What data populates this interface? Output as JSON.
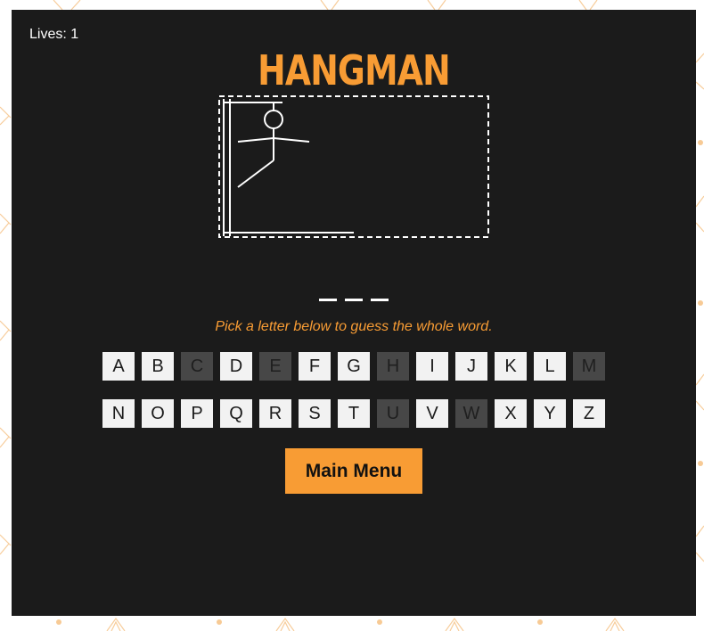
{
  "game": {
    "lives_label": "Lives: 1",
    "title": "HANGMAN",
    "instructions": "Pick a letter below to guess the whole word.",
    "word_slots": [
      "",
      "",
      ""
    ],
    "keyboard_rows": [
      [
        {
          "letter": "A",
          "used": false
        },
        {
          "letter": "B",
          "used": false
        },
        {
          "letter": "C",
          "used": true
        },
        {
          "letter": "D",
          "used": false
        },
        {
          "letter": "E",
          "used": true
        },
        {
          "letter": "F",
          "used": false
        },
        {
          "letter": "G",
          "used": false
        },
        {
          "letter": "H",
          "used": true
        },
        {
          "letter": "I",
          "used": false
        },
        {
          "letter": "J",
          "used": false
        },
        {
          "letter": "K",
          "used": false
        },
        {
          "letter": "L",
          "used": false
        },
        {
          "letter": "M",
          "used": true
        }
      ],
      [
        {
          "letter": "N",
          "used": false
        },
        {
          "letter": "O",
          "used": false
        },
        {
          "letter": "P",
          "used": false
        },
        {
          "letter": "Q",
          "used": false
        },
        {
          "letter": "R",
          "used": false
        },
        {
          "letter": "S",
          "used": false
        },
        {
          "letter": "T",
          "used": false
        },
        {
          "letter": "U",
          "used": true
        },
        {
          "letter": "V",
          "used": false
        },
        {
          "letter": "W",
          "used": true
        },
        {
          "letter": "X",
          "used": false
        },
        {
          "letter": "Y",
          "used": false
        },
        {
          "letter": "Z",
          "used": false
        }
      ]
    ],
    "main_menu_label": "Main Menu"
  },
  "colors": {
    "panel_bg": "#1b1b1b",
    "accent": "#f89c34",
    "key_bg": "#f2f2f2",
    "key_used_bg": "#474747",
    "drawing": "#ffffff"
  }
}
